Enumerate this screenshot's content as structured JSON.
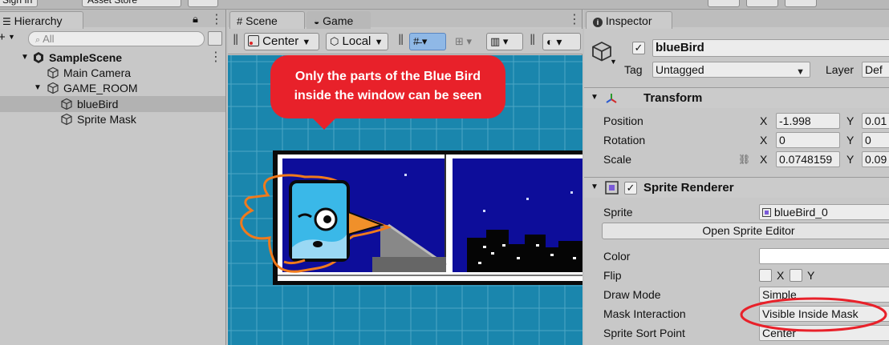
{
  "toolbar": {
    "signin_label": "Sign In",
    "asset_store_label": "Asset Store"
  },
  "hierarchy": {
    "tab_label": "Hierarchy",
    "add_label": "+",
    "search_placeholder": "All",
    "items": [
      {
        "label": "SampleScene",
        "type": "scene"
      },
      {
        "label": "Main Camera",
        "type": "object"
      },
      {
        "label": "GAME_ROOM",
        "type": "object"
      },
      {
        "label": "blueBird",
        "type": "object",
        "selected": true
      },
      {
        "label": "Sprite Mask",
        "type": "object"
      }
    ]
  },
  "scene": {
    "tabs": [
      {
        "label": "Scene",
        "active": true
      },
      {
        "label": "Game",
        "active": false
      }
    ],
    "toolbar": {
      "pivot_label": "Center",
      "space_label": "Local"
    }
  },
  "callout": {
    "line1": "Only the parts of the Blue Bird",
    "line2": "inside the window can be seen"
  },
  "inspector": {
    "tab_label": "Inspector",
    "object_name": "blueBird",
    "active": true,
    "tag_label": "Tag",
    "tag_value": "Untagged",
    "layer_label": "Layer",
    "layer_value": "Def",
    "transform": {
      "title": "Transform",
      "position_label": "Position",
      "rotation_label": "Rotation",
      "scale_label": "Scale",
      "x_label": "X",
      "y_label": "Y",
      "position_x": "-1.998",
      "position_y": "0.01",
      "rotation_x": "0",
      "rotation_y": "0",
      "scale_x": "0.0748159",
      "scale_y": "0.09"
    },
    "sprite_renderer": {
      "title": "Sprite Renderer",
      "enabled": true,
      "sprite_label": "Sprite",
      "sprite_value": "blueBird_0",
      "open_editor_label": "Open Sprite Editor",
      "color_label": "Color",
      "color_value": "#ffffff",
      "flip_label": "Flip",
      "flip_x_label": "X",
      "flip_y_label": "Y",
      "draw_mode_label": "Draw Mode",
      "draw_mode_value": "Simple",
      "mask_interaction_label": "Mask Interaction",
      "mask_interaction_value": "Visible Inside Mask",
      "sort_point_label": "Sprite Sort Point",
      "sort_point_value": "Center"
    }
  },
  "colors": {
    "accent_red": "#e8212a",
    "viewport_blue": "#1a86ad",
    "night_sky": "#0d0d9a",
    "bird_blue": "#3ab8e8",
    "beak_orange": "#f0902a"
  }
}
